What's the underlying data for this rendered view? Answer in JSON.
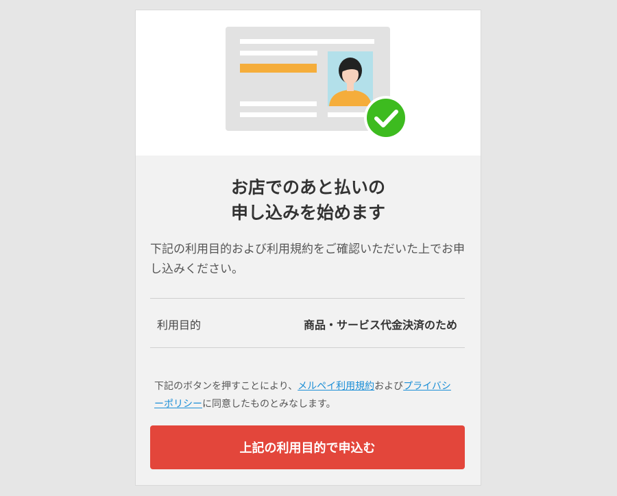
{
  "header": {
    "title_line1": "お店でのあと払いの",
    "title_line2": "申し込みを始めます"
  },
  "description": "下記の利用目的および利用規約をご確認いただいた上でお申し込みください。",
  "purpose": {
    "label": "利用目的",
    "value": "商品・サービス代金決済のため"
  },
  "consent": {
    "text_before": "下記のボタンを押すことにより、",
    "terms_link": "メルペイ利用規約",
    "text_middle": "および",
    "privacy_link": "プライバシーポリシー",
    "text_after": "に同意したものとみなします。"
  },
  "submit_button": "上記の利用目的で申込む",
  "icons": {
    "hero": "id-card-illustration",
    "badge": "check-icon"
  },
  "colors": {
    "primary_button": "#e3463b",
    "link": "#1a8ed6",
    "check_badge": "#3dbb1f",
    "accent_bar": "#f5ad3b"
  }
}
